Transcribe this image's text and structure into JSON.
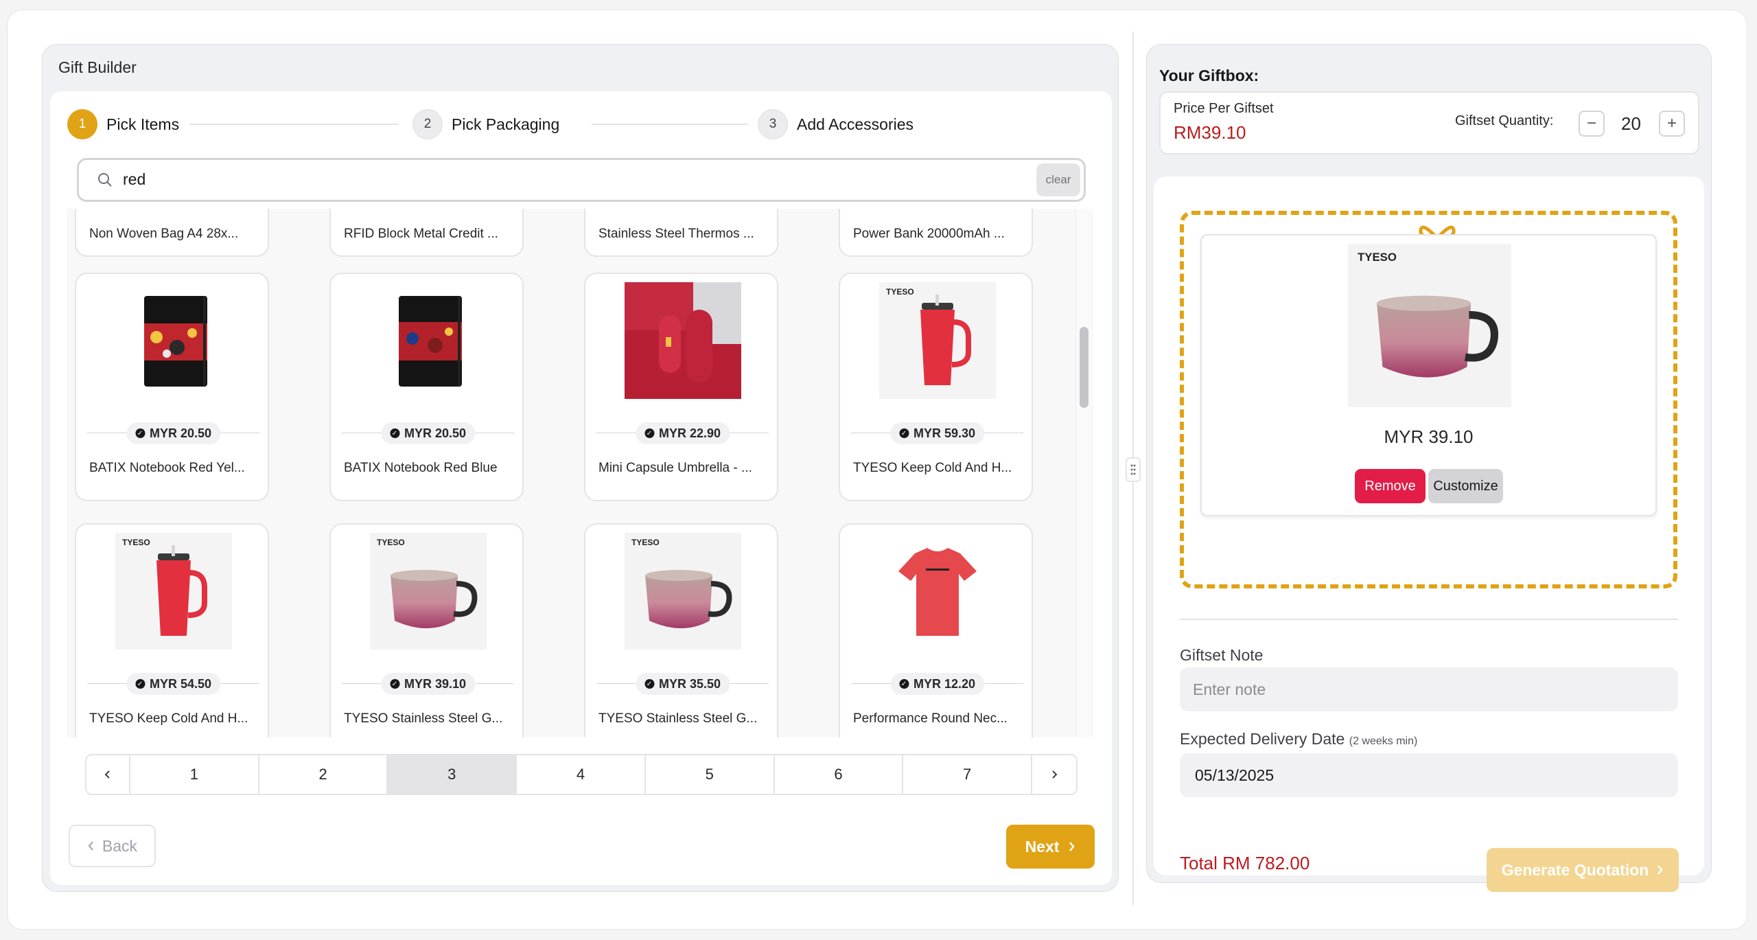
{
  "builder": {
    "title": "Gift Builder",
    "steps": [
      {
        "num": "1",
        "label": "Pick Items",
        "state": "active"
      },
      {
        "num": "2",
        "label": "Pick Packaging",
        "state": "idle"
      },
      {
        "num": "3",
        "label": "Add Accessories",
        "state": "idle"
      }
    ],
    "search": {
      "value": "red",
      "clear_label": "clear"
    },
    "partial_row": [
      {
        "name": "Non Woven Bag A4 28x..."
      },
      {
        "name": "RFID Block Metal Credit ..."
      },
      {
        "name": "Stainless Steel Thermos ..."
      },
      {
        "name": "Power Bank 20000mAh ..."
      }
    ],
    "products": [
      {
        "name": "BATIX Notebook Red Yel...",
        "price": "MYR 20.50",
        "image": "notebook-red-yellow"
      },
      {
        "name": "BATIX Notebook Red Blue",
        "price": "MYR 20.50",
        "image": "notebook-red-blue"
      },
      {
        "name": "Mini Capsule Umbrella - ...",
        "price": "MYR 22.90",
        "image": "capsule-umbrella"
      },
      {
        "name": "TYESO Keep Cold And H...",
        "price": "MYR 59.30",
        "image": "tumbler-red"
      },
      {
        "name": "TYESO Keep Cold And H...",
        "price": "MYR 54.50",
        "image": "tumbler-red"
      },
      {
        "name": "TYESO Stainless Steel G...",
        "price": "MYR 39.10",
        "image": "mug-pink"
      },
      {
        "name": "TYESO Stainless Steel G...",
        "price": "MYR 35.50",
        "image": "mug-pink"
      },
      {
        "name": "Performance Round Nec...",
        "price": "MYR 12.20",
        "image": "tshirt-red"
      }
    ],
    "pagination": {
      "pages": [
        "1",
        "2",
        "3",
        "4",
        "5",
        "6",
        "7"
      ],
      "current": "3",
      "prev_icon": "chevron-left-icon",
      "next_icon": "chevron-right-icon"
    },
    "back_label": "Back",
    "next_label": "Next"
  },
  "giftbox": {
    "title": "Your Giftbox:",
    "price_label": "Price Per Giftset",
    "price_value": "RM39.10",
    "qty_label": "Giftset Quantity:",
    "qty_minus": "−",
    "qty_plus": "+",
    "qty_value": "20",
    "item": {
      "brand": "TYESO",
      "price": "MYR 39.10",
      "remove_label": "Remove",
      "customize_label": "Customize"
    },
    "note_label": "Giftset Note",
    "note_placeholder": "Enter note",
    "delivery_label": "Expected Delivery Date",
    "delivery_hint": "(2 weeks min)",
    "delivery_value": "05/13/2025",
    "total": "Total RM 782.00",
    "generate_label": "Generate Quotation"
  },
  "colors": {
    "accent": "#e0a315",
    "price_red": "#b91c1c",
    "remove": "#e11d48"
  }
}
